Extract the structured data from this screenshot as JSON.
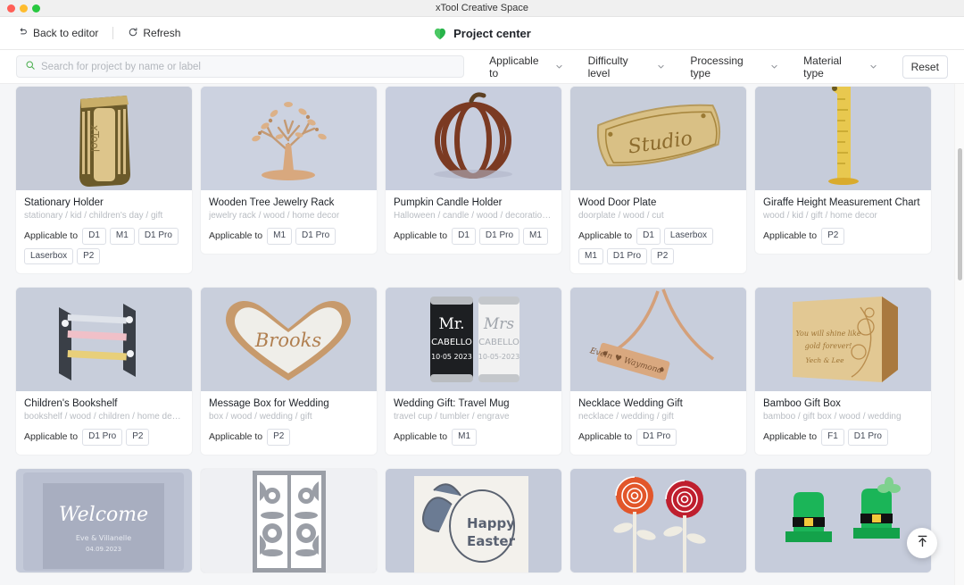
{
  "window": {
    "title": "xTool Creative Space",
    "controls": [
      "close",
      "minimize",
      "maximize"
    ]
  },
  "toolbar": {
    "back_label": "Back to editor",
    "back_icon": "undo-arrow-icon",
    "refresh_label": "Refresh",
    "refresh_icon": "refresh-icon",
    "center_title": "Project center",
    "logo_icon": "green-heart-logo",
    "accent_color": "#22c55e"
  },
  "search": {
    "placeholder": "Search for project by name or label",
    "value": "",
    "icon": "search-icon",
    "icon_color": "#4caf50"
  },
  "filters": [
    {
      "label": "Applicable to",
      "icon": "chevron-down-icon"
    },
    {
      "label": "Difficulty level",
      "icon": "chevron-down-icon"
    },
    {
      "label": "Processing type",
      "icon": "chevron-down-icon"
    },
    {
      "label": "Material type",
      "icon": "chevron-down-icon"
    }
  ],
  "reset_label": "Reset",
  "applicable_label": "Applicable to",
  "cards": [
    {
      "title": "Stationary Holder",
      "tags": "stationary / kid / children's day / gift",
      "devices": [
        "D1",
        "M1",
        "D1 Pro",
        "Laserbox",
        "P2"
      ],
      "image": "wooden-pen-holder"
    },
    {
      "title": "Wooden Tree Jewelry Rack",
      "tags": "jewelry rack / wood / home decor",
      "devices": [
        "M1",
        "D1 Pro"
      ],
      "image": "wooden-tree-jewelry-rack"
    },
    {
      "title": "Pumpkin Candle Holder",
      "tags": "Halloween / candle / wood / decoration /...",
      "devices": [
        "D1",
        "D1 Pro",
        "M1"
      ],
      "image": "pumpkin-candle-holder"
    },
    {
      "title": "Wood Door Plate",
      "tags": "doorplate / wood / cut",
      "devices": [
        "D1",
        "Laserbox",
        "M1",
        "D1 Pro",
        "P2"
      ],
      "image": "wood-door-plate-studio"
    },
    {
      "title": "Giraffe Height Measurement Chart",
      "tags": "wood / kid / gift / home decor",
      "devices": [
        "P2"
      ],
      "image": "giraffe-height-chart"
    },
    {
      "title": "Children's Bookshelf",
      "tags": "bookshelf / wood / children / home decor",
      "devices": [
        "D1 Pro",
        "P2"
      ],
      "image": "childrens-bookshelf"
    },
    {
      "title": "Message Box for Wedding",
      "tags": "box / wood / wedding / gift",
      "devices": [
        "P2"
      ],
      "image": "heart-message-box-brooks"
    },
    {
      "title": "Wedding Gift: Travel Mug",
      "tags": "travel cup / tumbler / engrave",
      "devices": [
        "M1"
      ],
      "image": "travel-mugs-mr-mrs-cabello"
    },
    {
      "title": "Necklace Wedding Gift",
      "tags": "necklace / wedding / gift",
      "devices": [
        "D1 Pro"
      ],
      "image": "engraved-bar-necklace"
    },
    {
      "title": "Bamboo Gift Box",
      "tags": "bamboo / gift box / wood / wedding",
      "devices": [
        "F1",
        "D1 Pro"
      ],
      "image": "bamboo-engraved-gift-box"
    }
  ],
  "partial_cards": [
    {
      "image": "welcome-acrylic-sign"
    },
    {
      "image": "filigree-panel-doors"
    },
    {
      "image": "happy-easter-bunny-card"
    },
    {
      "image": "paper-roses-pair"
    },
    {
      "image": "st-patricks-leprechaun-hats"
    }
  ],
  "to_top": {
    "icon": "arrow-up-to-line-icon",
    "label": ""
  }
}
